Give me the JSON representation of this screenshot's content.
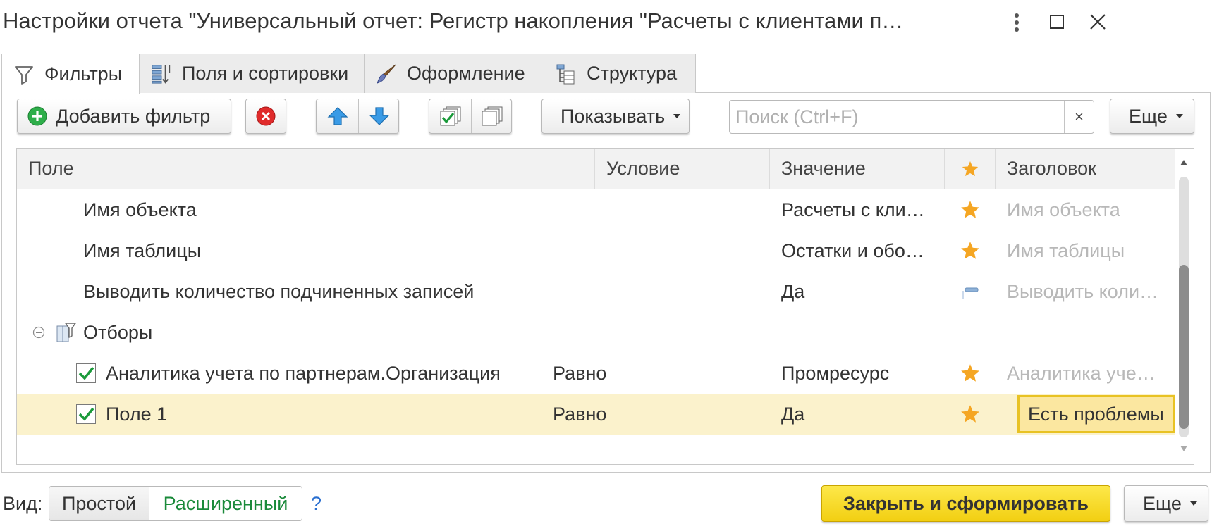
{
  "window": {
    "title": "Настройки отчета \"Универсальный отчет: Регистр накопления \"Расчеты с клиентами п…"
  },
  "tabs": [
    {
      "label": "Фильтры",
      "icon": "filter-icon",
      "active": true
    },
    {
      "label": "Поля и сортировки",
      "icon": "fields-sort-icon",
      "active": false
    },
    {
      "label": "Оформление",
      "icon": "brush-icon",
      "active": false
    },
    {
      "label": "Структура",
      "icon": "structure-icon",
      "active": false
    }
  ],
  "toolbar": {
    "add_filter_label": "Добавить фильтр",
    "show_label": "Показывать",
    "search_placeholder": "Поиск (Ctrl+F)",
    "search_clear": "×",
    "more_label": "Еще"
  },
  "table": {
    "columns": {
      "field": "Поле",
      "condition": "Условие",
      "value": "Значение",
      "title": "Заголовок"
    },
    "rows": [
      {
        "field": "Имя объекта",
        "condition": "",
        "value": "Расчеты с кли…",
        "star": "star",
        "title": "Имя объекта",
        "title_muted": true
      },
      {
        "field": "Имя таблицы",
        "condition": "",
        "value": "Остатки и обо…",
        "star": "star",
        "title": "Имя таблицы",
        "title_muted": true
      },
      {
        "field": "Выводить количество подчиненных записей",
        "condition": "",
        "value": "Да",
        "star": "dash",
        "title": "Выводить коли…",
        "title_muted": true
      },
      {
        "field": "Отборы",
        "group": true
      },
      {
        "field": "Аналитика учета по партнерам.Организация",
        "condition": "Равно",
        "value": "Промресурс",
        "star": "star",
        "title": "Аналитика уче…",
        "title_muted": true,
        "checked": true
      },
      {
        "field": "Поле 1",
        "condition": "Равно",
        "value": "Да",
        "star": "star",
        "title": "Есть проблемы",
        "title_muted": false,
        "checked": true,
        "selected": true
      }
    ]
  },
  "footer": {
    "view_label": "Вид:",
    "simple_label": "Простой",
    "extended_label": "Расширенный",
    "help_label": "?",
    "close_generate_label": "Закрыть и сформировать",
    "more_label": "Еще"
  },
  "colors": {
    "accent_yellow": "#f5d31c",
    "selected_row": "#fbf2cc",
    "star": "#f5a623",
    "extended_green": "#1a8a3a",
    "help_blue": "#2a6fd0"
  }
}
